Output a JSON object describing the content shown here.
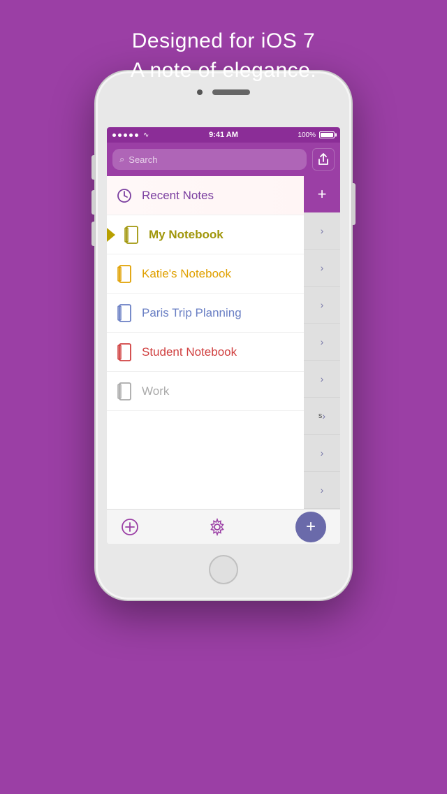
{
  "background_color": "#9b3fa5",
  "tagline": {
    "line1": "Designed for iOS 7",
    "line2": "A note of elegance."
  },
  "status_bar": {
    "time": "9:41 AM",
    "battery": "100%",
    "signal_dots": 5
  },
  "header": {
    "search_placeholder": "Search",
    "share_icon": "↑"
  },
  "notebooks": [
    {
      "id": "recent",
      "label": "Recent Notes",
      "icon_type": "clock",
      "color": "#7b3fa0",
      "active": false,
      "has_chevron": true
    },
    {
      "id": "my-notebook",
      "label": "My Notebook",
      "icon_type": "notebook",
      "color": "#a0960a",
      "active": true,
      "has_chevron": true
    },
    {
      "id": "katies-notebook",
      "label": "Katie's Notebook",
      "icon_type": "notebook",
      "color": "#e0a000",
      "active": false,
      "has_chevron": true
    },
    {
      "id": "paris-trip",
      "label": "Paris Trip Planning",
      "icon_type": "notebook",
      "color": "#6a7fc4",
      "active": false,
      "has_chevron": true
    },
    {
      "id": "student-notebook",
      "label": "Student Notebook",
      "icon_type": "notebook",
      "color": "#d04040",
      "active": false,
      "has_chevron": true
    },
    {
      "id": "work",
      "label": "Work",
      "icon_type": "notebook",
      "color": "#aaaaaa",
      "active": false,
      "has_chevron": true
    }
  ],
  "right_panel": {
    "add_label": "+",
    "chevrons": [
      "›",
      "›",
      "›",
      "›",
      "›",
      "›",
      "›",
      "›"
    ]
  },
  "bottom_toolbar": {
    "add_circle_label": "+",
    "settings_label": "⚙",
    "fab_label": "+"
  }
}
